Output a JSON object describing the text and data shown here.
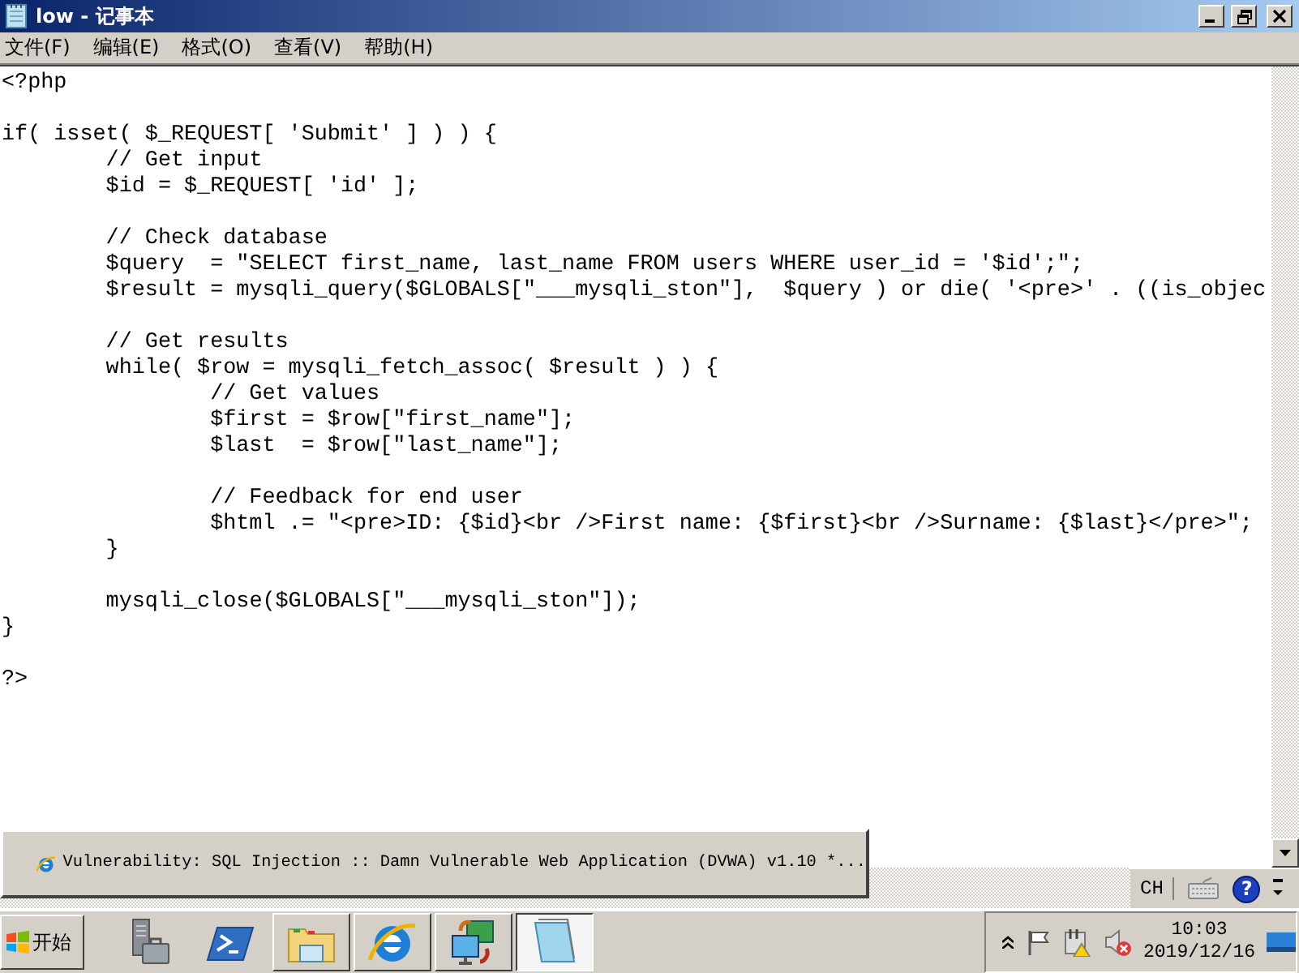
{
  "window": {
    "title": "low - 记事本"
  },
  "menu": [
    {
      "label": "文件(F)"
    },
    {
      "label": "编辑(E)"
    },
    {
      "label": "格式(O)"
    },
    {
      "label": "查看(V)"
    },
    {
      "label": "帮助(H)"
    }
  ],
  "editor": {
    "text": "<?php\n\nif( isset( $_REQUEST[ 'Submit' ] ) ) {\n\t// Get input\n\t$id = $_REQUEST[ 'id' ];\n\n\t// Check database\n\t$query  = \"SELECT first_name, last_name FROM users WHERE user_id = '$id';\";\n\t$result = mysqli_query($GLOBALS[\"___mysqli_ston\"],  $query ) or die( '<pre>' . ((is_objec\n\n\t// Get results\n\twhile( $row = mysqli_fetch_assoc( $result ) ) {\n\t\t// Get values\n\t\t$first = $row[\"first_name\"];\n\t\t$last  = $row[\"last_name\"];\n\n\t\t// Feedback for end user\n\t\t$html .= \"<pre>ID: {$id}<br />First name: {$first}<br />Surname: {$last}</pre>\";\n\t}\n\n\tmysqli_close($GLOBALS[\"___mysqli_ston\"]);\n}\n\n?>"
  },
  "preview": {
    "title": "Vulnerability: SQL Injection :: Damn Vulnerable Web Application (DVWA) v1.10 *..."
  },
  "language_bar": {
    "language": "CH",
    "help": "?"
  },
  "taskbar": {
    "start": "开始",
    "items": [
      {
        "kind": "launch",
        "selected": false
      },
      {
        "kind": "launch",
        "selected": false
      },
      {
        "kind": "window",
        "selected": false
      },
      {
        "kind": "window",
        "selected": false
      },
      {
        "kind": "window",
        "selected": false
      },
      {
        "kind": "window",
        "selected": true
      }
    ],
    "time": "10:03",
    "date": "2019/12/16"
  }
}
